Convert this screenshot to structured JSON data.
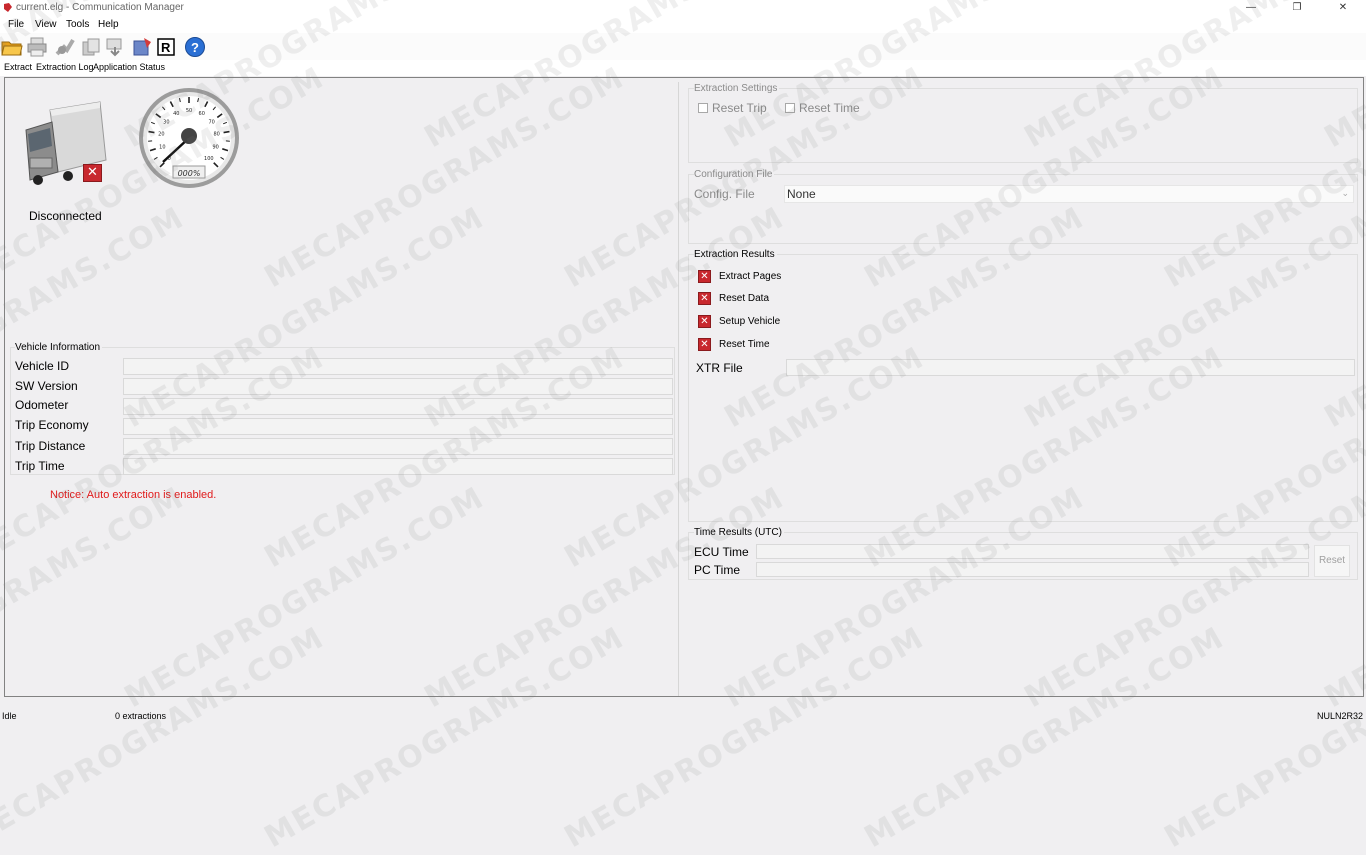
{
  "window": {
    "title": "current.elg - Communication Manager",
    "controls": [
      "minimize",
      "maximize",
      "close"
    ]
  },
  "menu": [
    "File",
    "View",
    "Tools",
    "Help"
  ],
  "toolbar": {
    "icons": [
      "open-folder-icon",
      "print-icon",
      "connect-icon",
      "copy-icon",
      "transfer-icon",
      "database-icon",
      "r-logo-icon",
      "help-icon"
    ]
  },
  "tabs": [
    "Extract",
    "Extraction Log",
    "Application Status"
  ],
  "connection": {
    "status": "Disconnected",
    "progress_text": "000%",
    "gauge_ticks": [
      "0",
      "10",
      "20",
      "30",
      "40",
      "50",
      "60",
      "70",
      "80",
      "90",
      "100"
    ]
  },
  "vehicle_info": {
    "title": "Vehicle Information",
    "fields": [
      {
        "label": "Vehicle ID",
        "value": ""
      },
      {
        "label": "SW Version",
        "value": ""
      },
      {
        "label": "Odometer",
        "value": ""
      },
      {
        "label": "Trip Economy",
        "value": ""
      },
      {
        "label": "Trip Distance",
        "value": ""
      },
      {
        "label": "Trip Time",
        "value": ""
      }
    ],
    "notice": "Notice: Auto extraction is enabled."
  },
  "extraction_settings": {
    "title": "Extraction Settings",
    "reset_trip": "Reset Trip",
    "reset_time": "Reset Time"
  },
  "config_file": {
    "title": "Configuration File",
    "label": "Config. File",
    "value": "None"
  },
  "extraction_results": {
    "title": "Extraction Results",
    "items": [
      "Extract Pages",
      "Reset Data",
      "Setup Vehicle",
      "Reset Time"
    ],
    "xtr_label": "XTR File",
    "xtr_value": ""
  },
  "time_results": {
    "title": "Time Results (UTC)",
    "ecu_label": "ECU Time",
    "pc_label": "PC Time",
    "reset_button": "Reset"
  },
  "status_bar": {
    "state": "Idle",
    "extractions": "0 extractions",
    "id": "NULN2R32"
  },
  "watermark": "MECAPROGRAMS.COM"
}
